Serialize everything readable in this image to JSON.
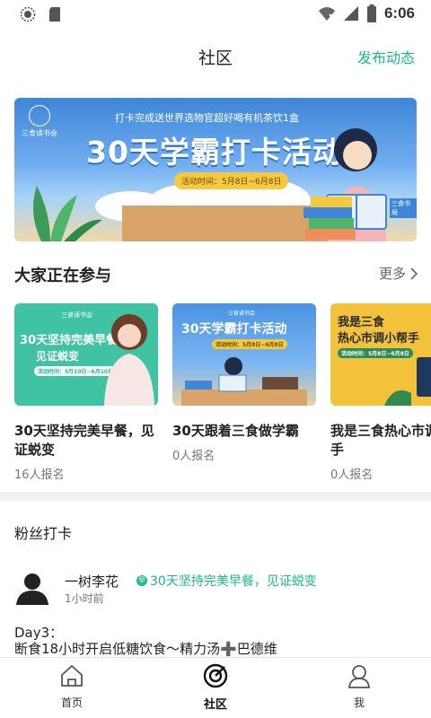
{
  "status_bar": {
    "time": "6:06"
  },
  "header": {
    "title": "社区",
    "publish_label": "发布动态"
  },
  "banner": {
    "subtitle": "打卡完成送世界选物官超好喝有机茶饮1盒",
    "title": "30天学霸打卡活动",
    "time_label": "活动时间：5月8日~6月8日",
    "logo_text": "三食读书会",
    "book_label": "三食书局"
  },
  "participating": {
    "title": "大家正在参与",
    "more_label": "更多",
    "items": [
      {
        "title": "30天坚持完美早餐，见证蜕变",
        "count": "16人报名",
        "image_title": "30天坚持完美早餐",
        "image_sub": "见证蜕变",
        "image_time": "活动时间：5月10日~6月10日",
        "image_logo": "三食读书会",
        "bg": "#3fc3a3"
      },
      {
        "title": "30天跟着三食做学霸",
        "count": "0人报名",
        "image_title": "30天学霸打卡活动",
        "image_time": "活动时间：5月8日~6月8日",
        "image_logo": "三食读书会",
        "bg": "#5aa3ec"
      },
      {
        "title": "我是三食热心市调小帮手",
        "count": "0人报名",
        "image_title": "我是三食",
        "image_sub": "热心市调小帮手",
        "image_time": "活动时间：5月8日~6月8日",
        "bg": "#f3c23b"
      }
    ]
  },
  "fans": {
    "title": "粉丝打卡",
    "post": {
      "user": "一树李花",
      "time": "1小时前",
      "tag": "30天坚持完美早餐，见证蜕变",
      "tag_icon": "早",
      "line1": "Day3：",
      "line2": "断食18小时开启低糖饮食～精力汤➕巴德维"
    }
  },
  "bottom_nav": {
    "items": [
      {
        "label": "首页",
        "icon": "home-icon"
      },
      {
        "label": "社区",
        "icon": "community-icon",
        "active": true
      },
      {
        "label": "我",
        "icon": "profile-icon"
      }
    ]
  },
  "colors": {
    "accent": "#1fb88a",
    "divider": "#f2f2f2"
  }
}
